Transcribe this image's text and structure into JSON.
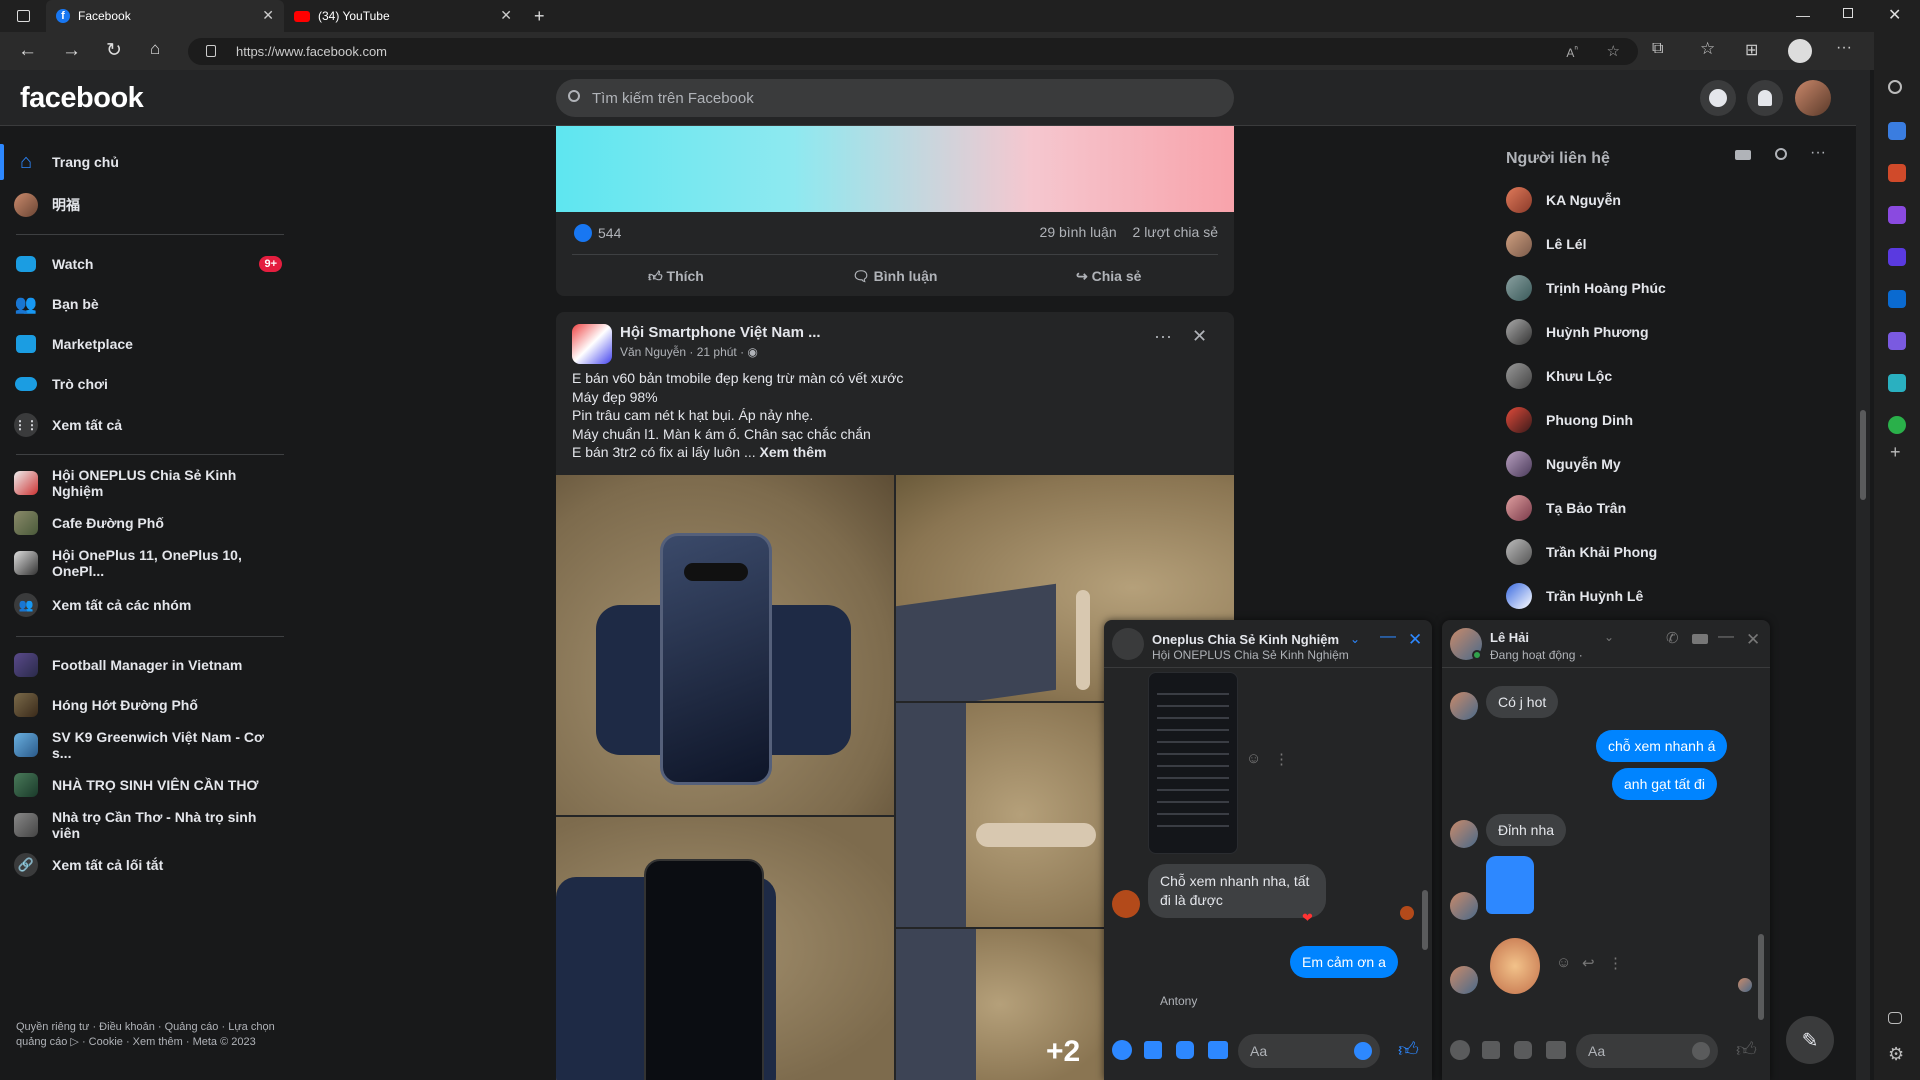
{
  "browser": {
    "tabs": [
      {
        "title": "Facebook"
      },
      {
        "title": "(34) YouTube"
      }
    ],
    "url": "https://www.facebook.com",
    "colors": {
      "fb_blue": "#1877f2",
      "youtube_red": "#ff0000"
    }
  },
  "header": {
    "logo": "facebook",
    "search_placeholder": "Tìm kiếm trên Facebook"
  },
  "sidebar": {
    "main": [
      {
        "label": "Trang chủ",
        "icon": "home-icon"
      },
      {
        "label": "明福",
        "icon": "avatar"
      },
      {
        "label": "Watch",
        "icon": "watch-icon",
        "badge": "9+"
      },
      {
        "label": "Bạn bè",
        "icon": "friends-icon"
      },
      {
        "label": "Marketplace",
        "icon": "marketplace-icon"
      },
      {
        "label": "Trò chơi",
        "icon": "gaming-icon"
      },
      {
        "label": "Xem tất cả",
        "icon": "grid-icon"
      }
    ],
    "groups": [
      {
        "label": "Hội ONEPLUS Chia Sẻ Kinh Nghiệm"
      },
      {
        "label": "Cafe Đường Phố"
      },
      {
        "label": "Hội OnePlus 11, OnePlus 10, OnePl..."
      },
      {
        "label": "Xem tất cả các nhóm"
      }
    ],
    "shortcuts": [
      {
        "label": "Football Manager in Vietnam"
      },
      {
        "label": "Hóng Hớt Đường Phố"
      },
      {
        "label": "SV K9 Greenwich Việt Nam - Cơ s..."
      },
      {
        "label": "NHÀ TRỌ SINH VIÊN CẦN THƠ"
      },
      {
        "label": "Nhà trọ Cần Thơ - Nhà trọ sinh viên"
      },
      {
        "label": "Xem tất cả lối tắt"
      }
    ],
    "footer": "Quyền riêng tư · Điều khoản · Quảng cáo · Lựa chọn quảng cáo ▷ · Cookie · Xem thêm · Meta © 2023"
  },
  "post1": {
    "likes": "544",
    "comments": "29 bình luận",
    "shares": "2 lượt chia sẻ",
    "actions": {
      "like": "Thích",
      "comment": "Bình luận",
      "share": "Chia sẻ"
    }
  },
  "post2": {
    "group": "Hội Smartphone Việt Nam ...",
    "author_meta": "Văn Nguyễn · 21 phút ·",
    "lines": [
      "E bán v60 bản tmobile đẹp keng trừ màn có vết xước",
      "Máy đẹp 98%",
      "Pin trâu cam nét k hạt bụi. Áp nảy nhẹ.",
      "Máy chuẩn l1. Màn k ám ố. Chân sạc chắc chắn",
      "E bán 3tr2 có fix ai lấy luôn ..."
    ],
    "see_more": "Xem thêm",
    "more_photos": "+2"
  },
  "contacts": {
    "title": "Người liên hệ",
    "list": [
      {
        "name": "KA Nguyễn"
      },
      {
        "name": "Lê Lél"
      },
      {
        "name": "Trịnh Hoàng Phúc"
      },
      {
        "name": "Huỳnh Phương"
      },
      {
        "name": "Khưu Lộc"
      },
      {
        "name": "Phuong Dinh"
      },
      {
        "name": "Nguyễn My"
      },
      {
        "name": "Tạ Bảo Trân"
      },
      {
        "name": "Trần Khải Phong"
      },
      {
        "name": "Trần Huỳnh Lê"
      }
    ]
  },
  "chat_group": {
    "title": "Oneplus Chia Sẻ Kinh Nghiệm",
    "subtitle": "Hội ONEPLUS Chia Sẻ Kinh Nghiệm",
    "msg_in": "Chỗ xem nhanh nha, tất đi là được",
    "msg_out": "Em cảm ơn a",
    "next_sender": "Antony",
    "input_placeholder": "Aa"
  },
  "chat_dm": {
    "title": "Lê Hải",
    "status": "Đang hoạt động ·",
    "messages": [
      {
        "dir": "in",
        "text": "Có j hot"
      },
      {
        "dir": "out",
        "text": "chỗ xem nhanh á"
      },
      {
        "dir": "out",
        "text": "anh gạt tất đi"
      },
      {
        "dir": "in",
        "text": "Đỉnh nha"
      }
    ],
    "input_placeholder": "Aa"
  }
}
